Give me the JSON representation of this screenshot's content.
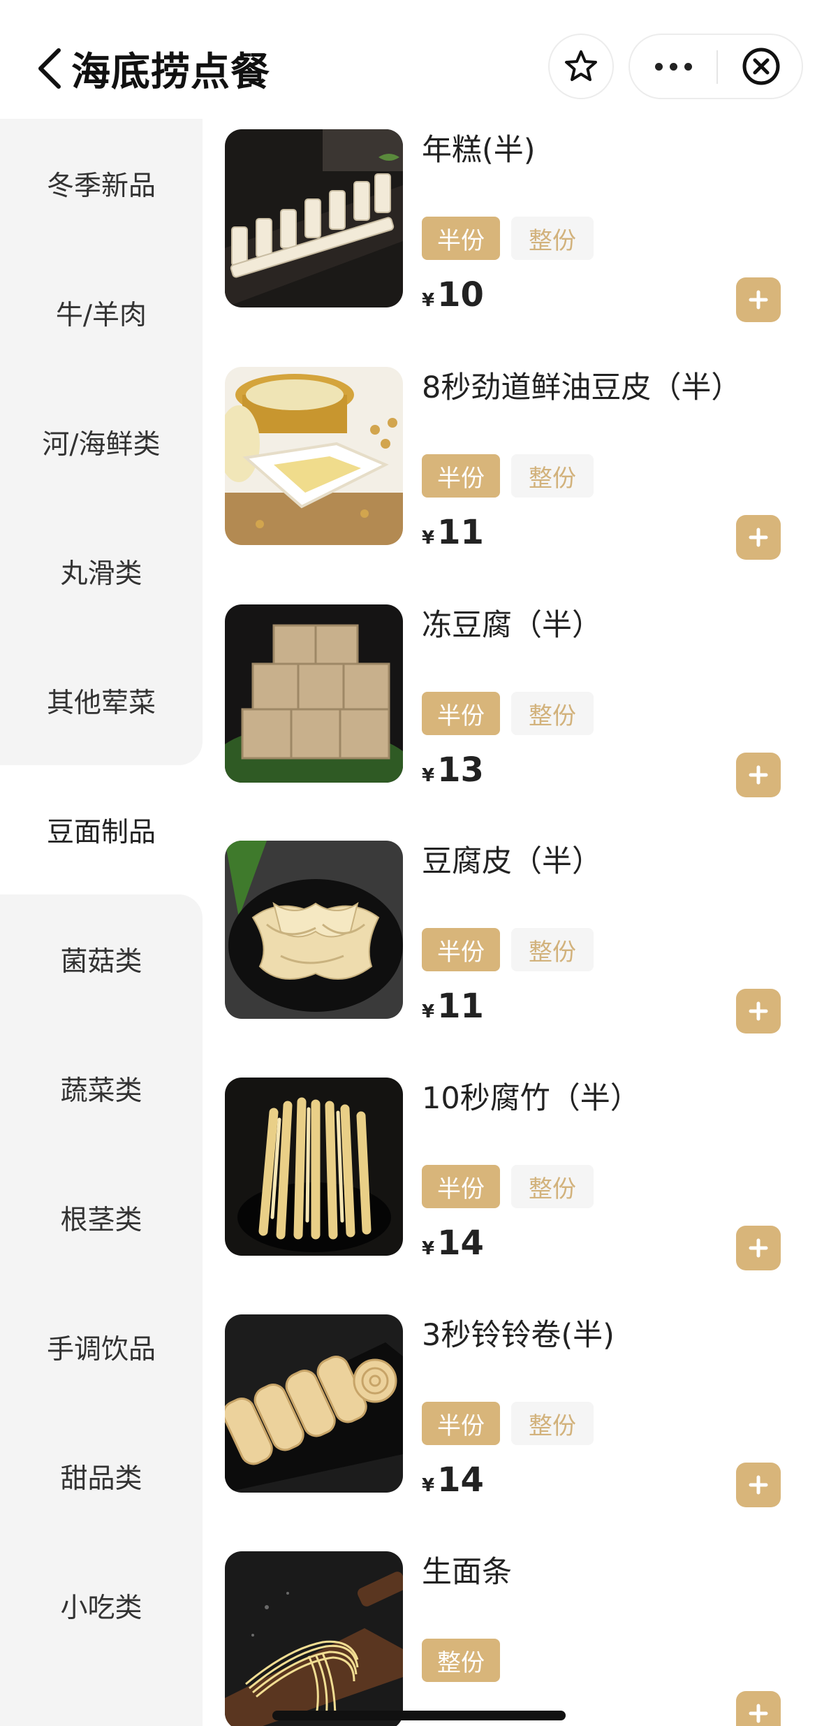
{
  "header": {
    "title": "海底捞点餐",
    "icons": {
      "back": "chevron-left-icon",
      "favorite": "star-icon",
      "more": "more-icon",
      "close": "close-circle-icon"
    }
  },
  "sidebar": {
    "active_index": 5,
    "categories": [
      {
        "label": "冬季新品"
      },
      {
        "label": "牛/羊肉"
      },
      {
        "label": "河/海鲜类"
      },
      {
        "label": "丸滑类"
      },
      {
        "label": "其他荤菜"
      },
      {
        "label": "豆面制品"
      },
      {
        "label": "菌菇类"
      },
      {
        "label": "蔬菜类"
      },
      {
        "label": "根茎类"
      },
      {
        "label": "手调饮品"
      },
      {
        "label": "甜品类"
      },
      {
        "label": "小吃类"
      }
    ]
  },
  "products": [
    {
      "name": "年糕(半)",
      "spec_half": "半份",
      "spec_full": "整份",
      "currency": "¥",
      "price": "10"
    },
    {
      "name": "8秒劲道鲜油豆皮（半）",
      "spec_half": "半份",
      "spec_full": "整份",
      "currency": "¥",
      "price": "11"
    },
    {
      "name": "冻豆腐（半）",
      "spec_half": "半份",
      "spec_full": "整份",
      "currency": "¥",
      "price": "13"
    },
    {
      "name": "豆腐皮（半）",
      "spec_half": "半份",
      "spec_full": "整份",
      "currency": "¥",
      "price": "11"
    },
    {
      "name": "10秒腐竹（半）",
      "spec_half": "半份",
      "spec_full": "整份",
      "currency": "¥",
      "price": "14"
    },
    {
      "name": "3秒铃铃卷(半)",
      "spec_half": "半份",
      "spec_full": "整份",
      "currency": "¥",
      "price": "14"
    },
    {
      "name": "生面条",
      "spec_full": "整份"
    }
  ],
  "colors": {
    "accent": "#d8b57a",
    "sidebar_bg": "#f4f4f4",
    "unselected_spec_bg": "#f5f5f5"
  }
}
